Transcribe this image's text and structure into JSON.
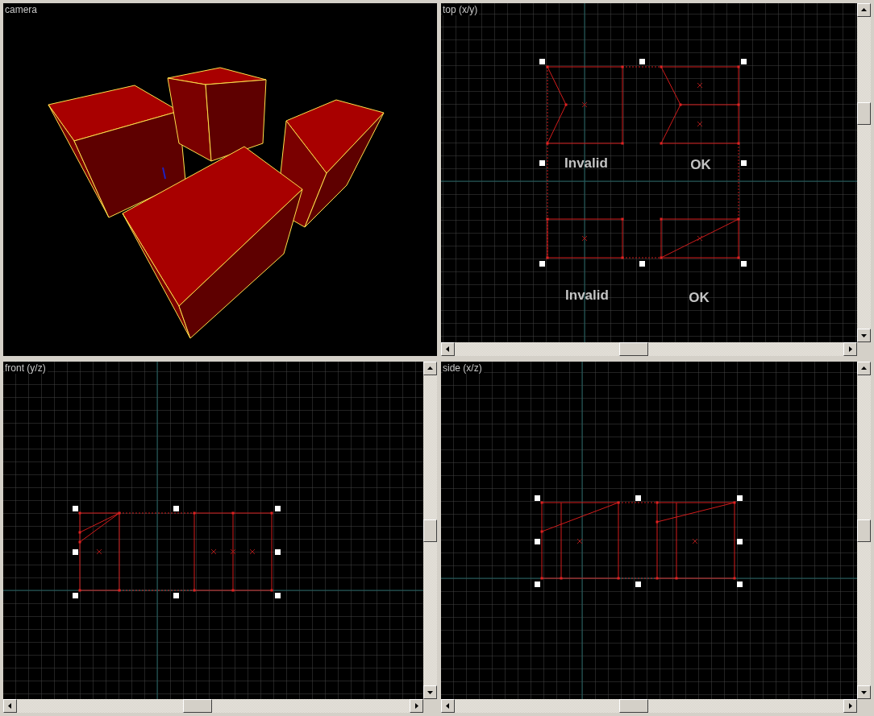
{
  "viewports": [
    {
      "kind": "camera",
      "label": "camera"
    },
    {
      "kind": "top",
      "label": "top (x/y)",
      "annotations": [
        "Invalid",
        "OK",
        "Invalid",
        "OK"
      ]
    },
    {
      "kind": "front",
      "label": "front (y/z)"
    },
    {
      "kind": "side",
      "label": "side (x/z)"
    }
  ]
}
